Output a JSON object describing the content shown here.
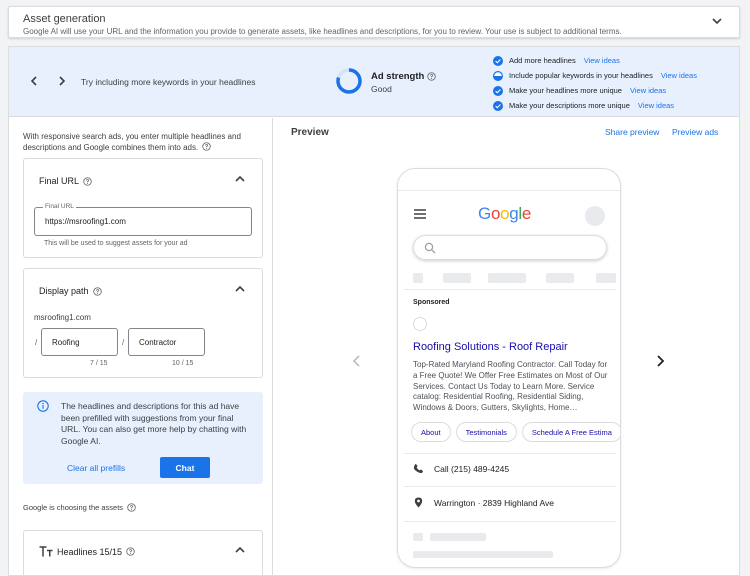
{
  "asset_generation": {
    "title": "Asset generation",
    "description": "Google AI will use your URL and the information you provide to generate assets, like headlines and descriptions, for you to review. Your use is subject to additional terms."
  },
  "strength_bar": {
    "tip": "Try including more keywords in your headlines",
    "label": "Ad strength",
    "value": "Good",
    "suggestions": [
      {
        "text": "Add more headlines",
        "link": "View ideas",
        "state": "done"
      },
      {
        "text": "Include popular keywords in your headlines",
        "link": "View ideas",
        "state": "partial"
      },
      {
        "text": "Make your headlines more unique",
        "link": "View ideas",
        "state": "done"
      },
      {
        "text": "Make your descriptions more unique",
        "link": "View ideas",
        "state": "done"
      }
    ]
  },
  "left": {
    "intro": "With responsive search ads, you enter multiple headlines and descriptions and Google combines them into ads.",
    "final_url": {
      "title": "Final URL",
      "field_label": "Final URL",
      "value": "https://msroofing1.com",
      "helper": "This will be used to suggest assets for your ad"
    },
    "display_path": {
      "title": "Display path",
      "domain": "msroofing1.com",
      "path1": "Roofing",
      "path1_count": "7 / 15",
      "path2": "Contractor",
      "path2_count": "10 / 15",
      "separator": "/"
    },
    "info": {
      "text": "The headlines and descriptions for this ad have been prefilled with suggestions from your final URL. You can also get more help by chatting with Google AI.",
      "clear_label": "Clear all prefills",
      "chat_label": "Chat"
    },
    "choosing": "Google is choosing the assets",
    "headlines": {
      "title": "Headlines 15/15"
    }
  },
  "preview": {
    "title": "Preview",
    "share_label": "Share preview",
    "ads_label": "Preview ads",
    "logo_letters": [
      "G",
      "o",
      "o",
      "g",
      "l",
      "e"
    ],
    "sponsored": "Sponsored",
    "headline": "Roofing Solutions - Roof Repair",
    "description": "Top-Rated Maryland Roofing Contractor. Call Today for a Free Quote! We Offer Free Estimates on Most of Our Services. Contact Us Today to Learn More. Service catalog: Residential Roofing, Residential Siding, Windows & Doors, Gutters, Skylights, Home…",
    "chips": [
      "About",
      "Testimonials",
      "Schedule A Free Estima"
    ],
    "phone": "Call (215) 489-4245",
    "location": "Warrington · 2839 Highland Ave"
  },
  "colors": {
    "accent": "#1a73e8",
    "ad_headline": "#1a0dab",
    "strength_bg": "#e8f0fe",
    "google_blue": "#4285f4",
    "google_red": "#ea4335",
    "google_yellow": "#fbbc05",
    "google_green": "#34a853"
  }
}
